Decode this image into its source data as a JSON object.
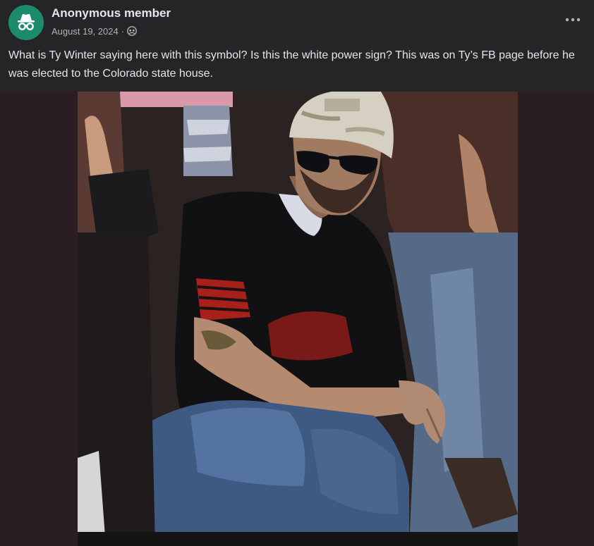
{
  "post": {
    "author": "Anonymous member",
    "date": "August 19, 2024",
    "separator": "·",
    "avatar_icon": "incognito-icon",
    "privacy_icon": "group-privacy-icon",
    "more_icon": "more-options-icon",
    "text": "What is Ty Winter saying here with this symbol? Is this the white power sign? This was on Ty’s FB page before he was elected to the Colorado state house."
  },
  "colors": {
    "avatar_bg": "#1c8b6a",
    "panel_bg": "#242526",
    "text_primary": "#e4e6eb",
    "text_secondary": "#b0b3b8",
    "photo_backdrop": "#2a1e22"
  }
}
